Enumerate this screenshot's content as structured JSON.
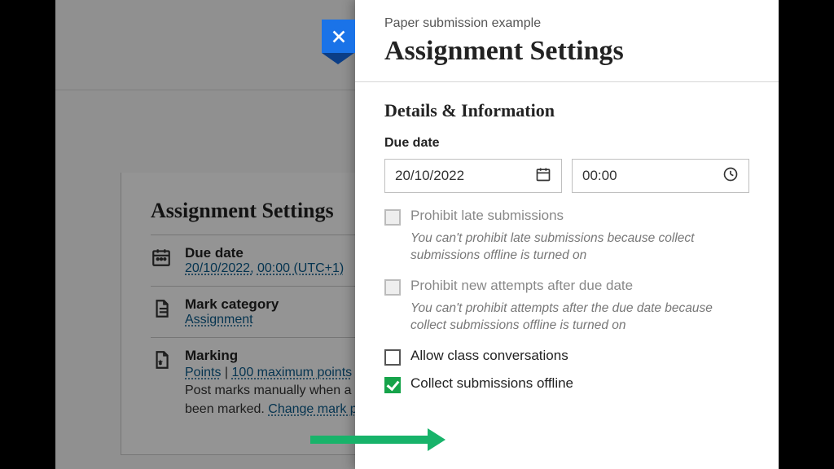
{
  "background": {
    "title": "Assignment Settings",
    "rows": {
      "due": {
        "label": "Due date",
        "date_link": "20/10/2022,",
        "time_link": "00:00 (UTC+1)"
      },
      "category": {
        "label": "Mark category",
        "value_link": "Assignment"
      },
      "marking": {
        "label": "Marking",
        "points": "Points",
        "sep": " | ",
        "max": "100 maximum points",
        "line2a": "Post marks manually when a",
        "line2b": "been marked. ",
        "change": "Change mark p"
      }
    }
  },
  "panel": {
    "pre_title": "Paper submission example",
    "title": "Assignment Settings",
    "section": "Details & Information",
    "due_label": "Due date",
    "date_value": "20/10/2022",
    "time_value": "00:00",
    "prohibit_late": {
      "label": "Prohibit late submissions",
      "hint": "You can't prohibit late submissions because collect submissions offline is turned on"
    },
    "prohibit_new": {
      "label": "Prohibit new attempts after due date",
      "hint": "You can't prohibit attempts after the due date because collect submissions offline is turned on"
    },
    "allow_conv": "Allow class conversations",
    "collect_offline": "Collect submissions offline"
  }
}
